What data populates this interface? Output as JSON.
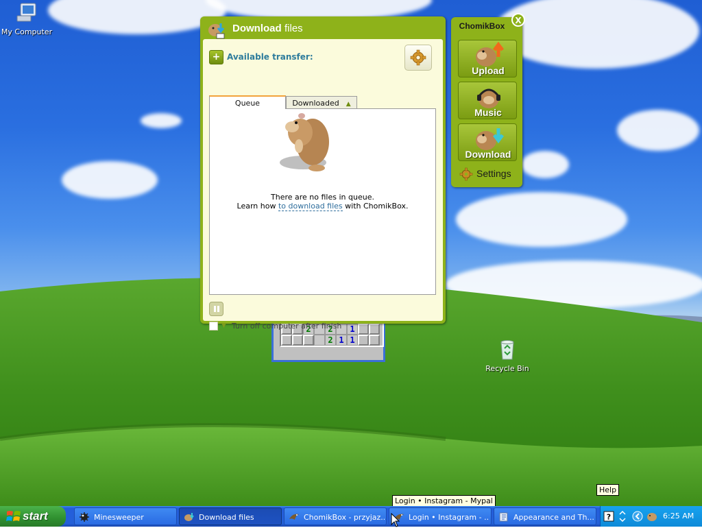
{
  "desktop": {
    "icons": [
      {
        "label": "My Computer"
      },
      {
        "label": "Recycle Bin"
      }
    ]
  },
  "minesweeper_fragment": {
    "rows": [
      [
        "",
        "",
        "2",
        "",
        "2",
        "",
        "1",
        "",
        ""
      ],
      [
        "",
        "",
        "",
        "",
        "2",
        "1",
        "1",
        "",
        ""
      ]
    ],
    "open": [
      [
        false,
        false,
        true,
        true,
        true,
        true,
        true,
        false,
        false
      ],
      [
        false,
        false,
        false,
        true,
        true,
        true,
        true,
        false,
        false
      ]
    ]
  },
  "download_window": {
    "title_bold": "Download",
    "title_rest": "files",
    "available_transfer_label": "Available transfer:",
    "tabs": [
      {
        "label": "Queue",
        "active": true
      },
      {
        "label": "Downloaded",
        "active": false
      }
    ],
    "empty_line1": "There are no files in queue.",
    "empty_line2_prefix": "Learn how ",
    "empty_link": "to download files",
    "empty_line2_suffix": " with ChomikBox.",
    "turn_off_label": "Turn off computer after finish"
  },
  "chomikbox_panel": {
    "title": "ChomikBox",
    "close_label": "X",
    "buttons": [
      {
        "label": "Upload"
      },
      {
        "label": "Music"
      },
      {
        "label": "Download"
      }
    ],
    "settings_label": "Settings"
  },
  "tooltips": {
    "taskbar_tooltip": "Login • Instagram - Mypal",
    "help_tooltip": "Help"
  },
  "taskbar": {
    "start_label": "start",
    "tasks": [
      {
        "label": "Minesweeper",
        "icon": "minesweeper-icon",
        "active": false
      },
      {
        "label": "Download files",
        "icon": "chomikbox-icon",
        "active": true
      },
      {
        "label": "ChomikBox - przyjaz...",
        "icon": "mypal-icon",
        "active": false
      },
      {
        "label": "Login • Instagram - ...",
        "icon": "mypal-icon",
        "active": false
      },
      {
        "label": "Appearance and Th...",
        "icon": "control-panel-icon",
        "active": false
      }
    ],
    "clock": "6:25 AM"
  },
  "colors": {
    "chomik_green": "#8eb21a",
    "window_body": "#fbfbdc",
    "link_blue": "#2e6d9c",
    "taskbar_blue": "#245edb",
    "start_green": "#3a9e3a",
    "tray_blue": "#0e8ad8"
  }
}
